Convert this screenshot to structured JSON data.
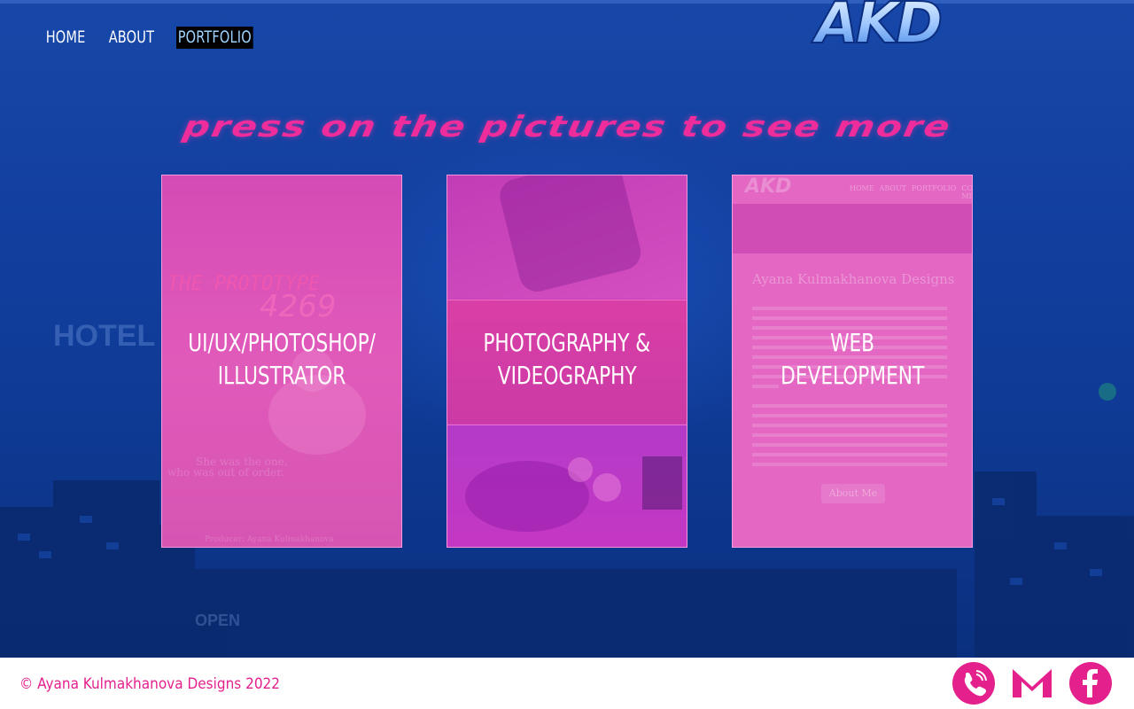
{
  "nav": {
    "items": [
      {
        "label": "HOME",
        "active": false
      },
      {
        "label": "ABOUT",
        "active": false
      },
      {
        "label": "PORTFOLIO",
        "active": true
      }
    ]
  },
  "logo": {
    "text": "AKD"
  },
  "headline": "press on the pictures to see more",
  "cards": [
    {
      "line1": "UI/UX/PHOTOSHOP/",
      "line2": "ILLUSTRATOR"
    },
    {
      "line1": "PHOTOGRAPHY &",
      "line2": "VIDEOGRAPHY"
    },
    {
      "line1": "WEB",
      "line2": "DEVELOPMENT"
    }
  ],
  "card1_poster": {
    "title": "THE PROTOTYPE",
    "number": "4269",
    "tagline1": "She was the one,",
    "tagline2": "who was out of order.",
    "producer": "Producer: Ayana Kulmakhanova"
  },
  "card3_preview": {
    "logo": "AKD",
    "nav": [
      "HOME",
      "ABOUT",
      "PORTFOLIO",
      "CONTACT ME"
    ],
    "heading": "Ayana Kulmakhanova Designs",
    "button": "About Me"
  },
  "footer": {
    "copyright": "© Ayana Kulmakhanova Designs 2022",
    "icons": [
      "phone-icon",
      "gmail-icon",
      "facebook-icon"
    ]
  },
  "colors": {
    "accent_pink": "#e4208d",
    "background_blue": "#123f9f",
    "footer_bg": "#ffffff"
  }
}
